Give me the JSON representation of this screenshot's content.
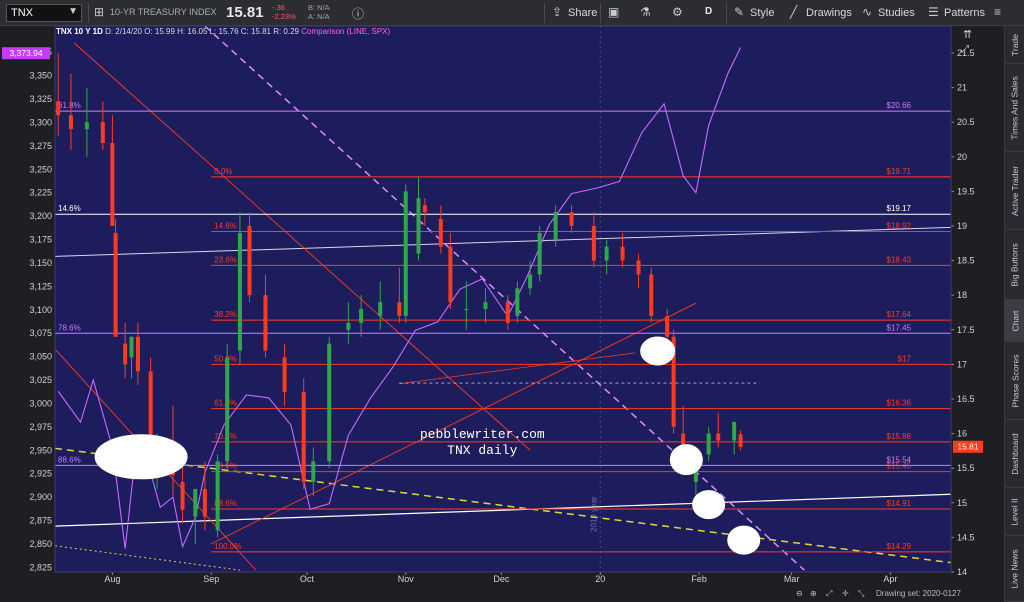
{
  "toolbar": {
    "symbol": "TNX",
    "description": "10-YR TREASURY INDEX",
    "last": "15.81",
    "change": "-.36",
    "change_pct": "-2.23%",
    "bid": "B: N/A",
    "ask": "A: N/A",
    "share_label": "Share",
    "period": "D",
    "style_label": "Style",
    "drawings_label": "Drawings",
    "studies_label": "Studies",
    "patterns_label": "Patterns"
  },
  "header": {
    "symbol": "TNX 10 Y 1D",
    "date": "D: 2/14/20",
    "ohlc": "O: 15.99  H: 16.05  L: 15.76  C: 15.81  R: 0.29",
    "comparison": "Comparison (LINE, SPX)"
  },
  "sidebar": [
    {
      "label": "Trade",
      "h": 38
    },
    {
      "label": "Times And Sales",
      "h": 88
    },
    {
      "label": "Active Trader",
      "h": 78
    },
    {
      "label": "Big Buttons",
      "h": 70
    },
    {
      "label": "Chart",
      "h": 42,
      "active": true
    },
    {
      "label": "Phase Scores",
      "h": 78
    },
    {
      "label": "Dashboard",
      "h": 68
    },
    {
      "label": "Level II",
      "h": 48
    },
    {
      "label": "Live News",
      "h": 66
    }
  ],
  "bottom": {
    "drawing_set": "Drawing set: 2020-0127"
  },
  "watermark": {
    "line1": "pebblewriter.com",
    "line2": "TNX daily"
  },
  "chart_data": {
    "type": "line",
    "series": [
      {
        "name": "TNX",
        "style": "candlestick",
        "axis": "right",
        "color_up": "#2ea84a",
        "color_down": "#ff3b1f",
        "x": [
          "2019-07-15",
          "2019-07-19",
          "2019-07-24",
          "2019-07-29",
          "2019-08-01",
          "2019-08-02",
          "2019-08-05",
          "2019-08-07",
          "2019-08-09",
          "2019-08-13",
          "2019-08-15",
          "2019-08-20",
          "2019-08-23",
          "2019-08-27",
          "2019-08-30",
          "2019-09-03",
          "2019-09-06",
          "2019-09-10",
          "2019-09-13",
          "2019-09-18",
          "2019-09-24",
          "2019-09-30",
          "2019-10-03",
          "2019-10-08",
          "2019-10-14",
          "2019-10-18",
          "2019-10-24",
          "2019-10-30",
          "2019-11-01",
          "2019-11-05",
          "2019-11-07",
          "2019-11-12",
          "2019-11-15",
          "2019-11-20",
          "2019-11-26",
          "2019-12-03",
          "2019-12-06",
          "2019-12-10",
          "2019-12-13",
          "2019-12-18",
          "2019-12-23",
          "2019-12-30",
          "2020-01-03",
          "2020-01-08",
          "2020-01-13",
          "2020-01-17",
          "2020-01-22",
          "2020-01-24",
          "2020-01-27",
          "2020-01-31",
          "2020-02-04",
          "2020-02-07",
          "2020-02-12",
          "2020-02-14"
        ],
        "open": [
          20.8,
          20.6,
          20.4,
          20.5,
          20.2,
          18.9,
          17.3,
          17.1,
          17.4,
          16.9,
          15.8,
          15.9,
          15.3,
          14.8,
          15.2,
          14.6,
          15.6,
          17.2,
          19.0,
          18.0,
          17.1,
          16.6,
          15.3,
          15.6,
          17.5,
          17.6,
          17.7,
          17.9,
          17.7,
          18.6,
          19.3,
          19.1,
          18.7,
          17.8,
          17.8,
          17.9,
          17.7,
          18.1,
          18.3,
          18.8,
          19.2,
          19.0,
          18.5,
          18.7,
          18.5,
          18.3,
          17.7,
          17.4,
          16.0,
          15.3,
          15.7,
          16.0,
          15.9,
          15.99
        ],
        "high": [
          21.5,
          21.2,
          21.0,
          20.8,
          20.6,
          19.1,
          17.6,
          17.4,
          17.6,
          17.1,
          16.0,
          16.4,
          15.6,
          15.2,
          15.6,
          15.7,
          17.3,
          19.2,
          19.2,
          18.3,
          17.3,
          16.8,
          15.8,
          17.4,
          17.9,
          18.0,
          18.2,
          18.4,
          19.6,
          19.7,
          19.4,
          19.3,
          18.9,
          18.2,
          18.1,
          18.0,
          18.2,
          18.5,
          19.0,
          19.3,
          19.3,
          19.2,
          18.8,
          18.9,
          18.6,
          18.4,
          17.8,
          17.5,
          16.4,
          15.8,
          16.1,
          16.3,
          16.1,
          16.05
        ],
        "low": [
          20.3,
          20.1,
          20.0,
          20.1,
          19.0,
          17.4,
          16.8,
          16.8,
          16.7,
          15.7,
          15.2,
          15.1,
          14.7,
          14.4,
          14.6,
          14.5,
          15.5,
          17.0,
          17.9,
          17.1,
          16.4,
          15.2,
          15.1,
          15.5,
          17.3,
          17.4,
          17.5,
          17.6,
          17.6,
          18.5,
          19.0,
          18.6,
          17.8,
          17.5,
          17.6,
          17.5,
          17.6,
          18.0,
          18.2,
          18.7,
          18.9,
          18.4,
          18.3,
          18.4,
          18.1,
          17.6,
          17.3,
          16.0,
          15.4,
          15.1,
          15.6,
          15.8,
          15.7,
          15.76
        ],
        "close": [
          20.6,
          20.4,
          20.5,
          20.2,
          19.0,
          17.4,
          17.0,
          17.4,
          16.9,
          15.8,
          15.9,
          15.4,
          14.9,
          15.2,
          14.8,
          15.6,
          17.1,
          18.9,
          18.0,
          17.2,
          16.6,
          15.3,
          15.6,
          17.3,
          17.6,
          17.8,
          17.9,
          17.7,
          19.5,
          19.4,
          19.2,
          18.7,
          17.9,
          17.8,
          17.9,
          17.6,
          18.1,
          18.3,
          18.9,
          19.2,
          19.0,
          18.5,
          18.7,
          18.5,
          18.3,
          17.7,
          17.4,
          16.1,
          15.5,
          15.7,
          16.0,
          15.9,
          16.17,
          15.81
        ]
      },
      {
        "name": "SPX",
        "style": "line",
        "axis": "left",
        "color": "#c66bff",
        "x": [
          "2019-07-15",
          "2019-07-22",
          "2019-07-26",
          "2019-08-01",
          "2019-08-05",
          "2019-08-08",
          "2019-08-13",
          "2019-08-16",
          "2019-08-20",
          "2019-08-23",
          "2019-08-27",
          "2019-08-30",
          "2019-09-05",
          "2019-09-12",
          "2019-09-19",
          "2019-09-26",
          "2019-10-02",
          "2019-10-08",
          "2019-10-14",
          "2019-10-21",
          "2019-10-28",
          "2019-11-04",
          "2019-11-11",
          "2019-11-18",
          "2019-11-25",
          "2019-12-03",
          "2019-12-09",
          "2019-12-16",
          "2019-12-23",
          "2019-12-31",
          "2020-01-07",
          "2020-01-14",
          "2020-01-21",
          "2020-01-27",
          "2020-01-31",
          "2020-02-04",
          "2020-02-10",
          "2020-02-14"
        ],
        "values": [
          3013,
          2980,
          3025,
          2953,
          2845,
          2938,
          2926,
          2889,
          2900,
          2847,
          2878,
          2926,
          2977,
          3009,
          3006,
          2977,
          2887,
          2893,
          2966,
          3006,
          3039,
          3078,
          3087,
          3122,
          3133,
          3093,
          3135,
          3191,
          3224,
          3230,
          3237,
          3289,
          3320,
          3243,
          3225,
          3297,
          3352,
          3380
        ]
      }
    ],
    "x_tick_labels": [
      "Aug",
      "Sep",
      "Oct",
      "Nov",
      "Dec",
      "20",
      "Feb",
      "Mar",
      "Apr"
    ],
    "x_tick_dates": [
      "2019-08-01",
      "2019-09-01",
      "2019-10-01",
      "2019-11-01",
      "2019-12-01",
      "2020-01-01",
      "2020-02-01",
      "2020-03-01",
      "2020-04-01"
    ],
    "xlim": [
      "2019-07-14",
      "2020-04-20"
    ],
    "y_right_ticks": [
      14,
      14.5,
      15,
      15.5,
      16,
      16.5,
      17,
      17.5,
      18,
      18.5,
      19,
      19.5,
      20,
      20.5,
      21,
      21.5
    ],
    "y_right_lim": [
      14.0,
      21.89
    ],
    "y_left_ticks": [
      2825,
      2850,
      2875,
      2900,
      2925,
      2950,
      2975,
      3000,
      3025,
      3050,
      3075,
      3100,
      3125,
      3150,
      3175,
      3200,
      3225,
      3250,
      3275,
      3300,
      3325,
      3350,
      3375,
      3400
    ],
    "y_left_lim": [
      2820,
      3403
    ],
    "left_price_badge": "3,373.94",
    "right_price_badge": "15.81",
    "grid": false,
    "fib_levels": [
      {
        "pct": "0.0%",
        "value": 19.71,
        "label": "$19.71",
        "color": "#ff3b1f",
        "x_start": "2019-09-01"
      },
      {
        "pct": "14.6%",
        "value": 18.92,
        "label": "$18.92",
        "color": "#ff3b1f",
        "x_start": "2019-09-01"
      },
      {
        "pct": "23.6%",
        "value": 18.43,
        "label": "$18.43",
        "color": "#ff3b1f",
        "x_start": "2019-09-01"
      },
      {
        "pct": "38.2%",
        "value": 17.64,
        "label": "$17.64",
        "color": "#ff3b1f",
        "x_start": "2019-09-01"
      },
      {
        "pct": "50.0%",
        "value": 17.0,
        "label": "$17",
        "color": "#ff3b1f",
        "x_start": "2019-09-01"
      },
      {
        "pct": "61.8%",
        "value": 16.36,
        "label": "$16.36",
        "color": "#ff3b1f",
        "x_start": "2019-09-01"
      },
      {
        "pct": "70.7%",
        "value": 15.88,
        "label": "$15.88",
        "color": "#ff3b1f",
        "x_start": "2019-09-01"
      },
      {
        "pct": "78.6%",
        "value": 15.45,
        "label": "$15.45",
        "color": "#ff3b1f",
        "x_start": "2019-09-01"
      },
      {
        "pct": "88.6%",
        "value": 14.91,
        "label": "$14.91",
        "color": "#ff3b1f",
        "x_start": "2019-09-01"
      },
      {
        "pct": "100.0%",
        "value": 14.29,
        "label": "$14.29",
        "color": "#ff3b1f",
        "x_start": "2019-09-01"
      },
      {
        "pct": "61.8%",
        "value": 20.66,
        "label": "$20.66",
        "color": "#d07bff",
        "x_start": "2019-07-14"
      },
      {
        "pct": "78.6%",
        "value": 17.45,
        "label": "$17.45",
        "color": "#d07bff",
        "x_start": "2019-07-14"
      },
      {
        "pct": "88.6%",
        "value": 15.54,
        "label": "$15.54",
        "color": "#d07bff",
        "x_start": "2019-07-14"
      },
      {
        "pct": "14.6%",
        "value": 19.17,
        "label": "$19.17",
        "color": "#ffffff",
        "x_start": "2019-07-14"
      }
    ],
    "annotation_vertical": "2019 year"
  }
}
